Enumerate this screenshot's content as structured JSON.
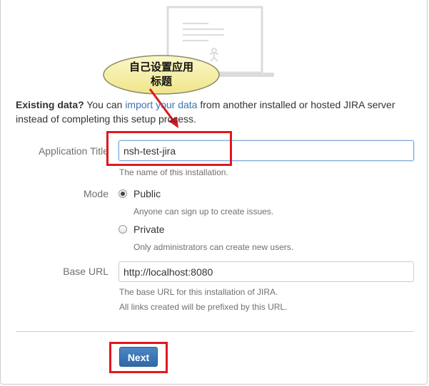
{
  "annotation": {
    "callout_text": "自己设置应用\n标题",
    "highlight_color": "#e0181e",
    "bubble_color": "#f7f1a7"
  },
  "intro": {
    "lead": "Existing data?",
    "before_link": " You can ",
    "link": "import your data",
    "after_link": " from another installed or hosted JIRA server instead of completing this setup process."
  },
  "form": {
    "app_title": {
      "label": "Application Title",
      "value": "nsh-test-jira",
      "hint": "The name of this installation."
    },
    "mode": {
      "label": "Mode",
      "options": [
        {
          "label": "Public",
          "hint": "Anyone can sign up to create issues.",
          "checked": true
        },
        {
          "label": "Private",
          "hint": "Only administrators can create new users.",
          "checked": false
        }
      ]
    },
    "base_url": {
      "label": "Base URL",
      "value": "http://localhost:8080",
      "hint_line1": "The base URL for this installation of JIRA.",
      "hint_line2": "All links created will be prefixed by this URL."
    },
    "submit_label": "Next"
  },
  "colors": {
    "link": "#3b73af",
    "primary_button": "#3572b0"
  }
}
